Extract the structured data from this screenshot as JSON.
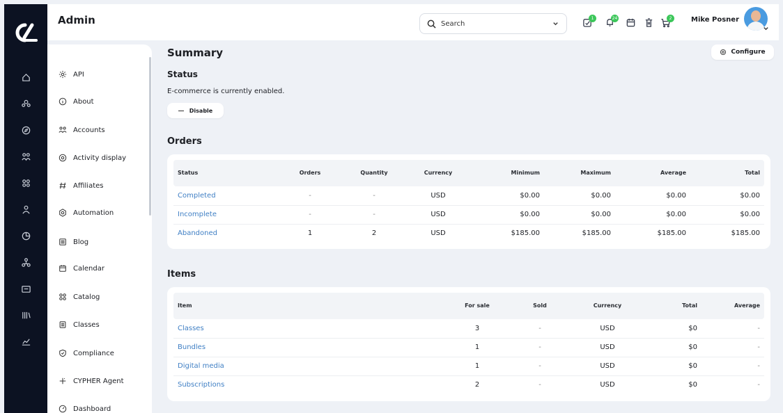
{
  "app": {
    "title": "Admin"
  },
  "header": {
    "search_placeholder": "Search",
    "user_name": "Mike Posner",
    "notifications": [
      {
        "icon": "check-badge-icon",
        "count": "1"
      },
      {
        "icon": "bell-badge-icon",
        "count": "24"
      },
      {
        "icon": "calendar-icon",
        "count": ""
      },
      {
        "icon": "trash-icon",
        "count": ""
      },
      {
        "icon": "cart-icon",
        "count": "2"
      }
    ]
  },
  "rail": {
    "icons": [
      "home-icon",
      "group-icon",
      "compass-icon",
      "people-icon",
      "grid-icon",
      "person-icon",
      "pie-chart-icon",
      "network-icon",
      "id-card-icon",
      "library-icon",
      "line-chart-icon"
    ]
  },
  "sidebar": {
    "items": [
      {
        "label": "API",
        "icon": "gear-icon"
      },
      {
        "label": "About",
        "icon": "info-icon"
      },
      {
        "label": "Accounts",
        "icon": "accounts-icon"
      },
      {
        "label": "Activity display",
        "icon": "activity-icon"
      },
      {
        "label": "Affiliates",
        "icon": "affiliates-icon"
      },
      {
        "label": "Automation",
        "icon": "automation-icon"
      },
      {
        "label": "Blog",
        "icon": "blog-icon"
      },
      {
        "label": "Calendar",
        "icon": "calendar-icon"
      },
      {
        "label": "Catalog",
        "icon": "catalog-icon"
      },
      {
        "label": "Classes",
        "icon": "classes-icon"
      },
      {
        "label": "Compliance",
        "icon": "shield-icon"
      },
      {
        "label": "CYPHER Agent",
        "icon": "sparkle-icon"
      },
      {
        "label": "Dashboard",
        "icon": "dashboard-icon"
      }
    ]
  },
  "main": {
    "title": "Summary",
    "configure_label": "Configure",
    "status": {
      "heading": "Status",
      "text": "E-commerce is currently enabled.",
      "disable_label": "Disable"
    },
    "orders": {
      "heading": "Orders",
      "columns": [
        "Status",
        "Orders",
        "Quantity",
        "Currency",
        "Minimum",
        "Maximum",
        "Average",
        "Total"
      ],
      "rows": [
        [
          "Completed",
          "-",
          "-",
          "USD",
          "$0.00",
          "$0.00",
          "$0.00",
          "$0.00"
        ],
        [
          "Incomplete",
          "-",
          "-",
          "USD",
          "$0.00",
          "$0.00",
          "$0.00",
          "$0.00"
        ],
        [
          "Abandoned",
          "1",
          "2",
          "USD",
          "$185.00",
          "$185.00",
          "$185.00",
          "$185.00"
        ]
      ]
    },
    "items": {
      "heading": "Items",
      "columns": [
        "Item",
        "For sale",
        "Sold",
        "Currency",
        "Total",
        "Average"
      ],
      "rows": [
        [
          "Classes",
          "3",
          "-",
          "USD",
          "$0",
          "-"
        ],
        [
          "Bundles",
          "1",
          "-",
          "USD",
          "$0",
          "-"
        ],
        [
          "Digital media",
          "1",
          "-",
          "USD",
          "$0",
          "-"
        ],
        [
          "Subscriptions",
          "2",
          "-",
          "USD",
          "$0",
          "-"
        ]
      ]
    }
  }
}
